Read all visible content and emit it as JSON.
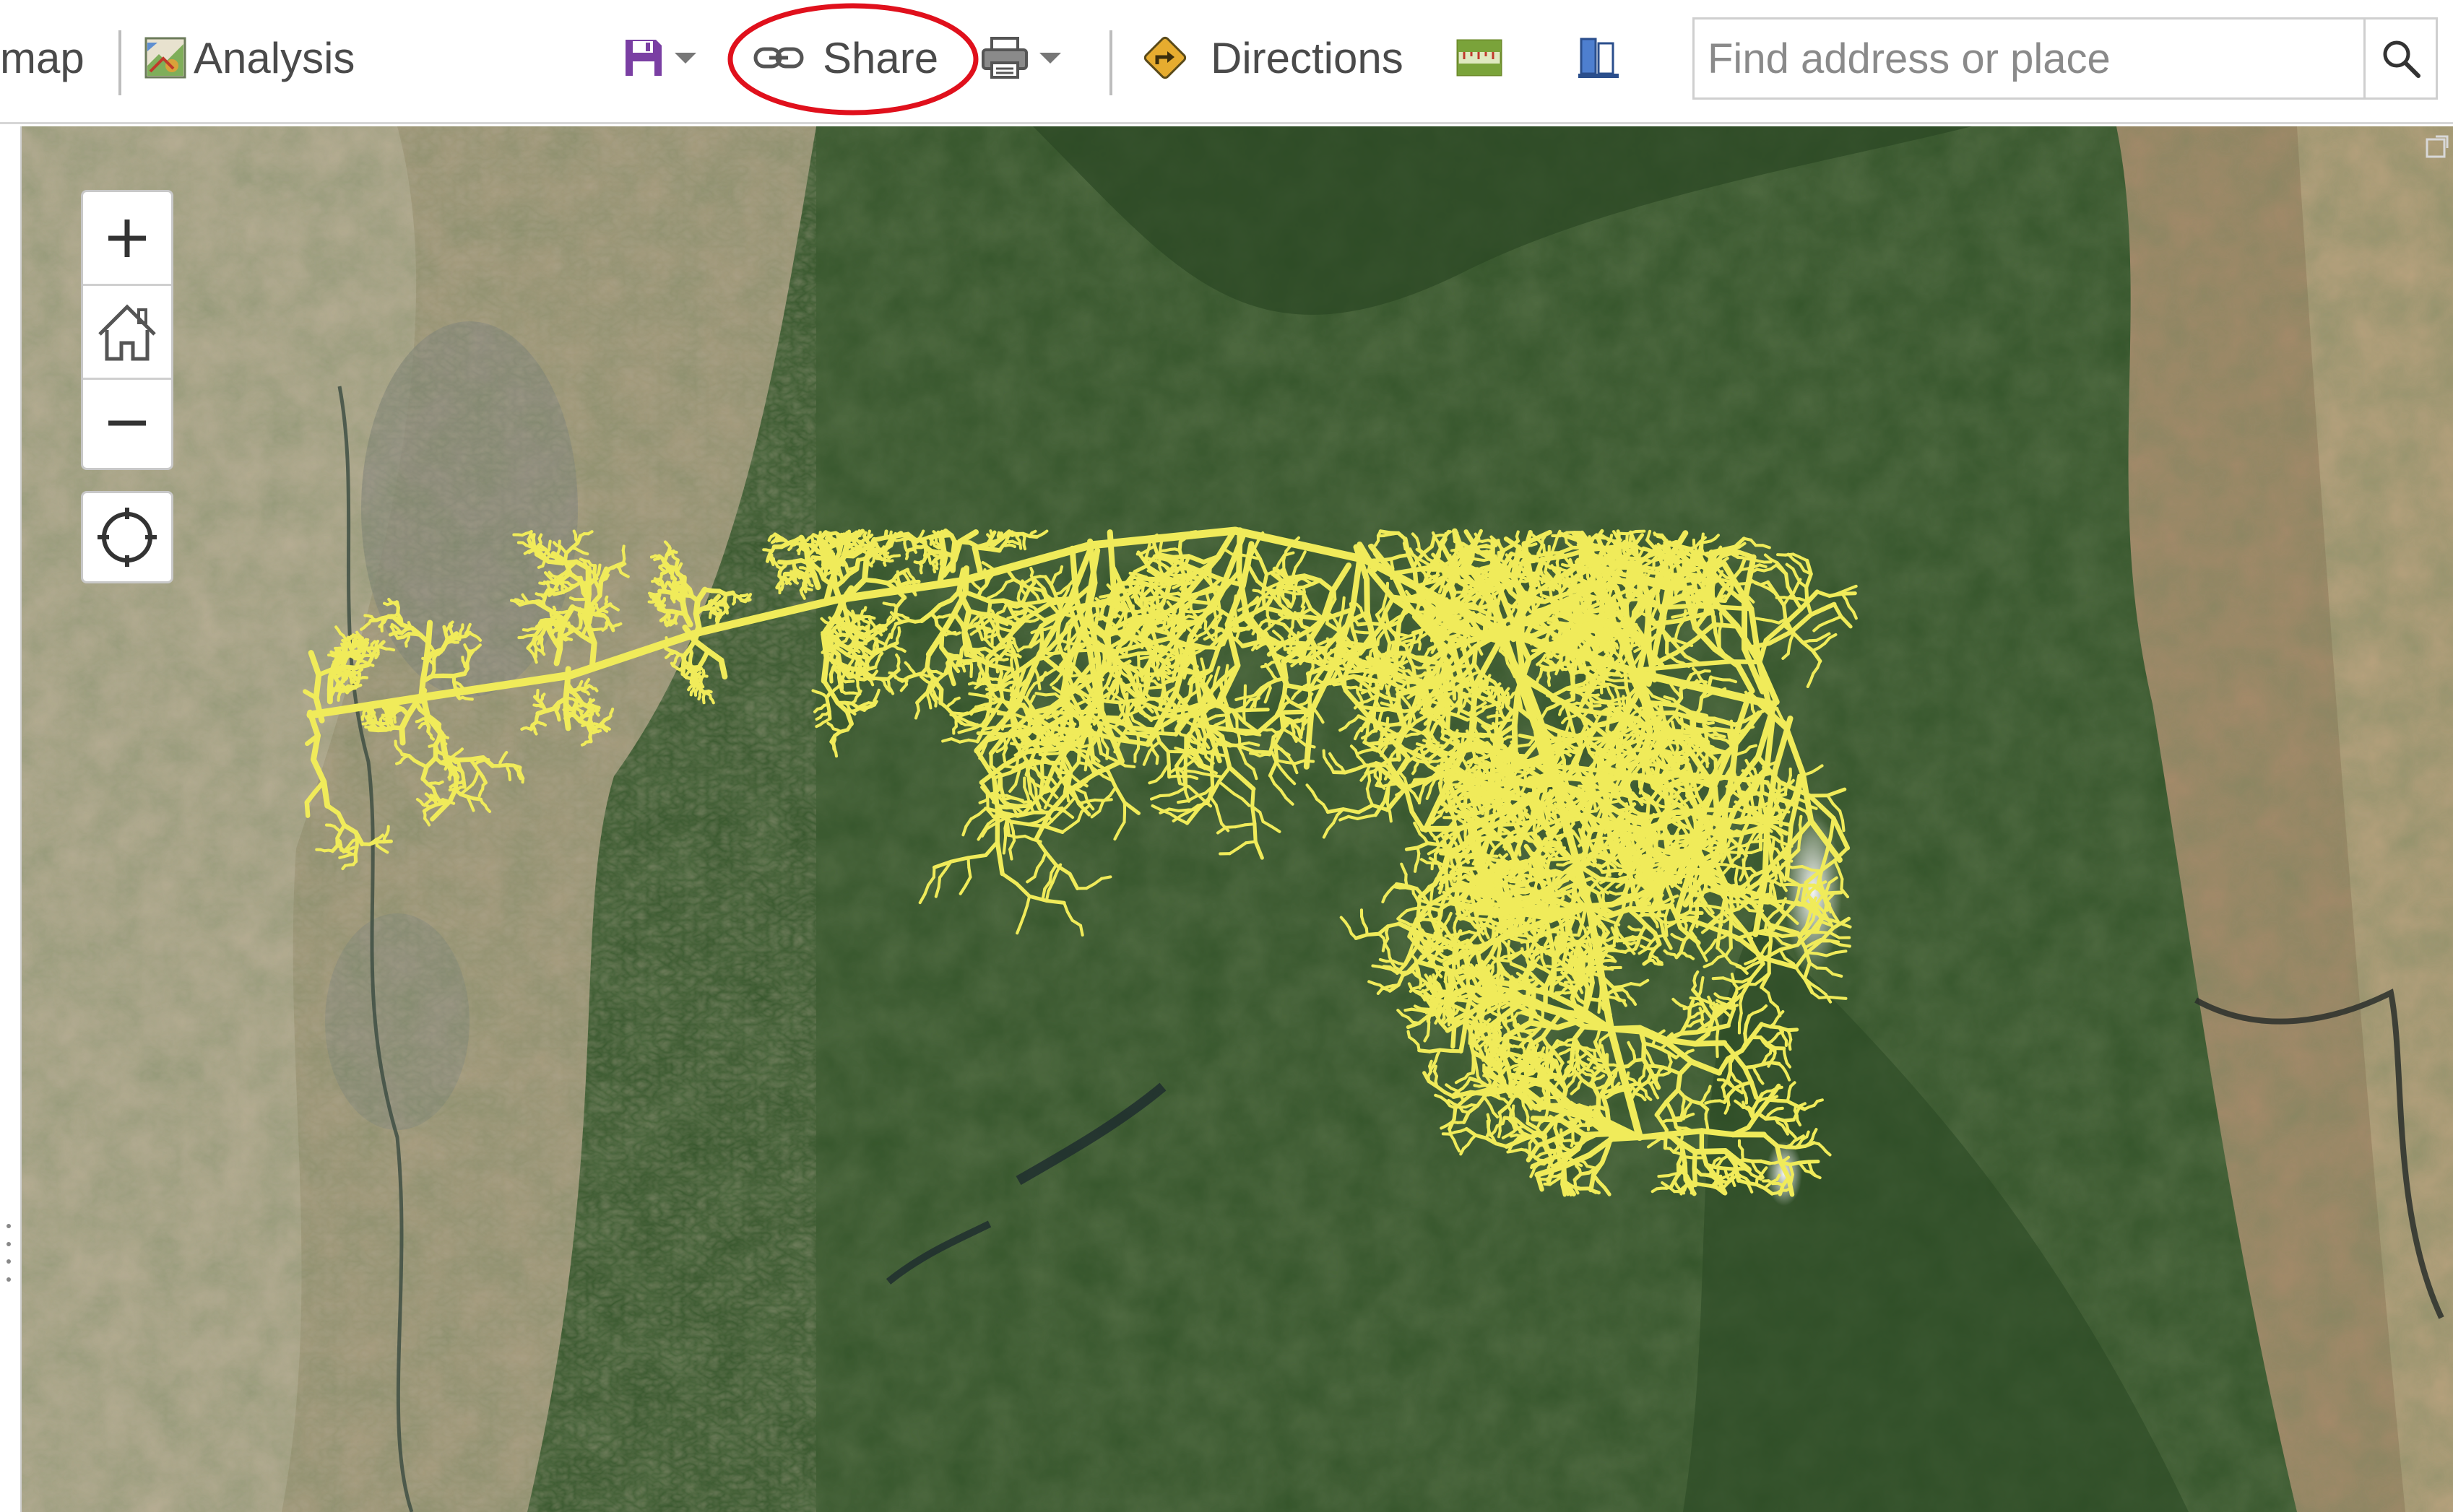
{
  "toolbar": {
    "basemap_fragment": "map",
    "analysis_label": "Analysis",
    "share_label": "Share",
    "directions_label": "Directions",
    "icons": [
      "analysis-icon",
      "save-icon",
      "link-icon",
      "print-icon",
      "directions-icon",
      "measure-icon",
      "bookmarks-icon",
      "search-icon"
    ]
  },
  "search": {
    "placeholder": "Find address or place"
  },
  "map_controls": {
    "zoom_in": "+",
    "zoom_out": "−"
  },
  "colors": {
    "highlight": "#e0101c",
    "river_network": "#f0eb5a",
    "forest": "#34542a",
    "farmland": "#b8ab90"
  }
}
